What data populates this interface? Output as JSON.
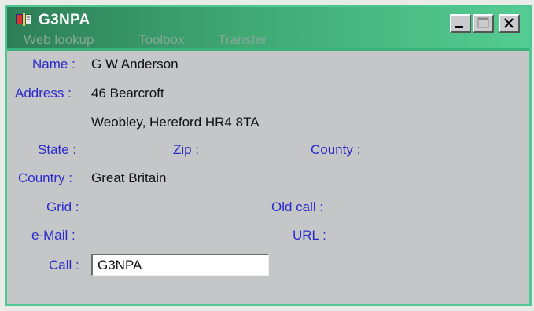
{
  "window": {
    "title": "G3NPA",
    "app_icon": "book-icon",
    "buttons": {
      "minimize_icon": "minimize-icon",
      "maximize_icon": "maximize-icon",
      "close_icon": "close-icon"
    },
    "accent_color": "#4fc793"
  },
  "menu": {
    "items": [
      {
        "label": "Web lookup"
      },
      {
        "label": "Toolbox"
      },
      {
        "label": "Transfer"
      }
    ]
  },
  "record": {
    "name_label": "Name :",
    "name_value": "G W Anderson",
    "address_label": "Address :",
    "address_line1": "46 Bearcroft",
    "address_line2": "Weobley, Hereford HR4 8TA",
    "state_label": "State :",
    "zip_label": "Zip :",
    "county_label": "County :",
    "country_label": "Country :",
    "country_value": "Great Britain",
    "grid_label": "Grid :",
    "oldcall_label": "Old call :",
    "email_label": "e-Mail :",
    "url_label": "URL :",
    "call_label": "Call :",
    "call_value": "G3NPA"
  }
}
